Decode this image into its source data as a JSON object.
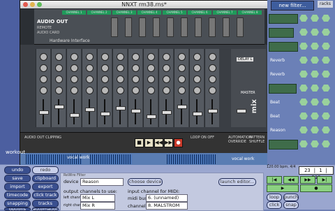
{
  "window": {
    "title": "NNXT rm38.rns*"
  },
  "mixer": {
    "channel_labels": [
      "CHANNEL 1",
      "CHANNEL 2",
      "CHANNEL 3",
      "CHANNEL 4",
      "CHANNEL 5",
      "CHANNEL 6",
      "CHANNEL 7",
      "CHANNEL 8"
    ],
    "audio_out_title": "AUDIO OUT",
    "audio_out_lines": [
      "REMOTE",
      "AUDIO CARD"
    ],
    "hardware_interface": "Hardware Interface",
    "master_label": "MASTER",
    "mix_logo": "mix",
    "delay_label": "DELAY L"
  },
  "transport": {
    "loop_label": "LOOP ON OFF",
    "automation_label": "AUTOMATION OVERRIDE",
    "pattern_label": "PATTERN SHUFFLE",
    "audio_out_clipping": "AUDIO OUT CLIPPING"
  },
  "tracks": {
    "workout": "workout",
    "vocal_work_1": "vocal work",
    "vocal_work_2": "vocal work"
  },
  "right_panel": {
    "new_filter": "new filter...",
    "racks": "racks",
    "items": [
      "Reverb",
      "Reverb",
      "Beat",
      "Beat",
      "Reason"
    ]
  },
  "bottom_left": {
    "buttons": [
      "undo",
      "redo",
      "save",
      "clipboard",
      "import",
      "export",
      "timecode",
      "click track",
      "snapping",
      "tracks",
      "options",
      "automation"
    ]
  },
  "filter_panel": {
    "header": "ReWire Filter",
    "device_label": "device",
    "device_value": "Reason",
    "choose_device": "choose device",
    "launch_editor": "launch editor...",
    "output_channels_label": "output channels to use:",
    "left_channel_label": "left channel",
    "left_channel_value": "Mix L",
    "right_channel_label": "right channel",
    "right_channel_value": "Mix R",
    "input_channel_label": "input channel for MIDI:",
    "midi_bus_label": "midi bus",
    "midi_bus_value": "6. (unnamed)",
    "channel_label": "channel",
    "channel_value": "8. MALSTROM"
  },
  "transport_panel": {
    "tempo": "120.00 bpm, 4/4",
    "position": "23 | 1 | 513",
    "loop": "loop",
    "punch": "punch",
    "click": "click",
    "snap": "snap"
  }
}
